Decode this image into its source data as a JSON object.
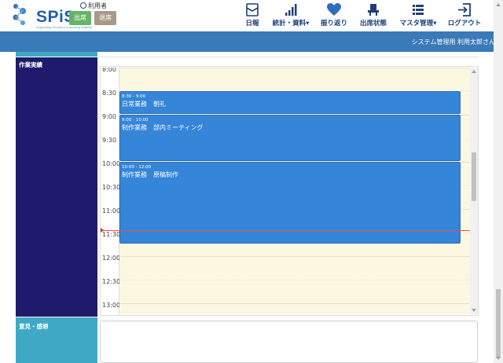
{
  "brand": {
    "logo_text": "SPiS",
    "logo_sub": "Supporting People in Improving Stability",
    "accent": "#3a7ab8"
  },
  "user": {
    "label": "利用者",
    "checkin_label": "出席",
    "checkout_label": "退席"
  },
  "nav": {
    "items": [
      {
        "label": "日報",
        "icon": "diary-icon"
      },
      {
        "label": "統計・資料▾",
        "icon": "bar-chart-icon"
      },
      {
        "label": "振り返り",
        "icon": "heart-icon"
      },
      {
        "label": "出席状態",
        "icon": "seat-icon"
      },
      {
        "label": "マスタ管理▾",
        "icon": "list-icon"
      },
      {
        "label": "ログアウト",
        "icon": "logout-icon"
      }
    ]
  },
  "topbar": {
    "admin_name": "システム管理用 利用太郎さん"
  },
  "sections": {
    "work_results_label": "作業実績",
    "opinion_label": "意見・感想"
  },
  "calendar": {
    "time_labels": [
      "8:00",
      "8:30",
      "9:00",
      "9:30",
      "10:00",
      "10:30",
      "11:00",
      "11:30",
      "12:00",
      "12:30",
      "13:00"
    ],
    "events": [
      {
        "time": "8:30 - 9:00",
        "title": "日常業務　朝礼",
        "start": 8.5,
        "end": 9.0
      },
      {
        "time": "9:00 - 10:00",
        "title": "制作業務　部内ミーティング",
        "start": 9.0,
        "end": 10.0
      },
      {
        "time": "10:00 - 12:00",
        "title": "制作業務　原稿制作",
        "start": 10.0,
        "end": 11.75
      }
    ],
    "now": 11.45
  },
  "opinion": {
    "value": ""
  }
}
